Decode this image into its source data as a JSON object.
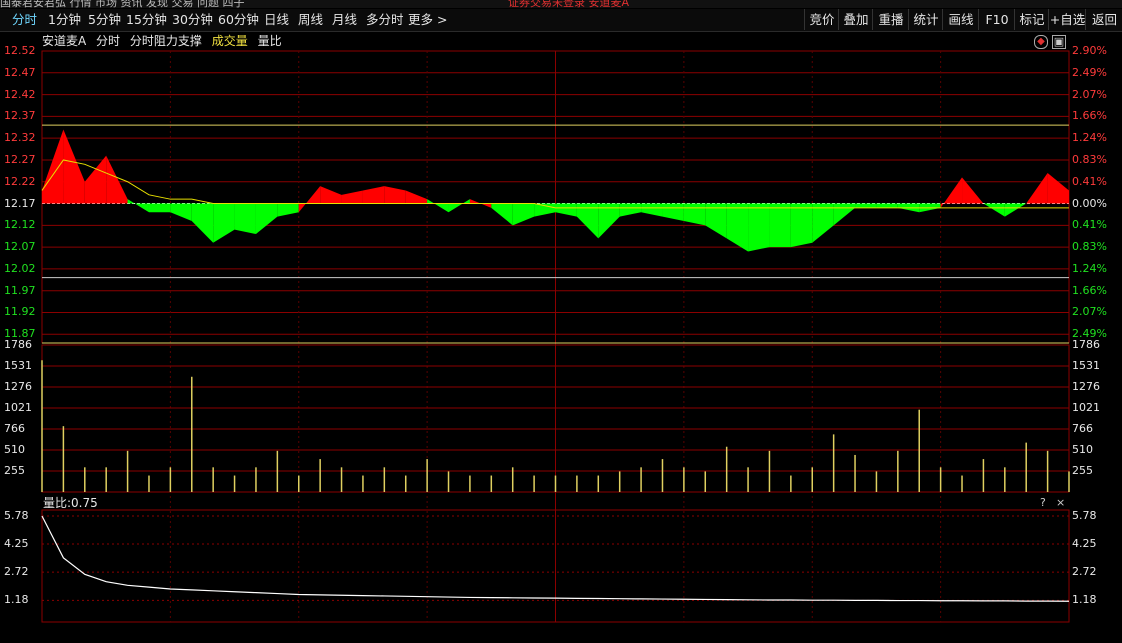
{
  "top_strip": {
    "left_text": "国泰君安君弘 行情 市场 资讯 发现 交易 问题 四子",
    "notice_text": "证券交易未登录  安道麦A"
  },
  "toolbar": {
    "tabs": [
      {
        "label": "分时",
        "active": true
      },
      {
        "label": "1分钟",
        "active": false
      },
      {
        "label": "5分钟",
        "active": false
      },
      {
        "label": "15分钟",
        "active": false
      },
      {
        "label": "30分钟",
        "active": false
      },
      {
        "label": "60分钟",
        "active": false
      },
      {
        "label": "日线",
        "active": false
      },
      {
        "label": "周线",
        "active": false
      },
      {
        "label": "月线",
        "active": false
      },
      {
        "label": "多分时",
        "active": false
      },
      {
        "label": "更多 >",
        "active": false
      }
    ],
    "right_buttons": [
      "竞价",
      "叠加",
      "重播",
      "统计",
      "画线",
      "F10",
      "标记",
      "+自选",
      "返回"
    ]
  },
  "price_panel": {
    "stock_name": "安道麦A",
    "title_items": [
      "分时",
      "分时阻力支撑"
    ],
    "volume_label": "成交量",
    "ratio_label": "量比",
    "prev_close": 12.17,
    "y_labels": [
      "12.52",
      "12.47",
      "12.42",
      "12.37",
      "12.32",
      "12.27",
      "12.22",
      "12.17",
      "12.12",
      "12.07",
      "12.02",
      "11.97",
      "11.92",
      "11.87"
    ],
    "pct_labels": [
      "2.90%",
      "2.49%",
      "2.07%",
      "1.66%",
      "1.24%",
      "0.83%",
      "0.41%",
      "0.00%",
      "0.41%",
      "0.83%",
      "1.24%",
      "1.66%",
      "2.07%",
      "2.49%"
    ],
    "resistance_line": 12.35,
    "support_line": 12.0,
    "colors": {
      "up": "#ff0000",
      "down": "#00ff00",
      "avg": "#e8e000",
      "grid": "#8b0000",
      "baseline": "#ffffff"
    }
  },
  "volume_panel": {
    "y_labels": [
      "1786",
      "1531",
      "1276",
      "1021",
      "766",
      "510",
      "255"
    ]
  },
  "ratio_panel": {
    "header": "量比:0.75",
    "y_labels": [
      "5.78",
      "4.25",
      "2.72",
      "1.18"
    ],
    "help_icon": "?",
    "close_icon": "×"
  },
  "chart_data": {
    "type": "line",
    "x": [
      0,
      5,
      10,
      15,
      20,
      25,
      30,
      35,
      40,
      45,
      50,
      55,
      60,
      65,
      70,
      75,
      80,
      85,
      90,
      95,
      100,
      105,
      110,
      115,
      120,
      125,
      130,
      135,
      140,
      145,
      150,
      155,
      160,
      165,
      170,
      175,
      180,
      185,
      190,
      195,
      200,
      205,
      210,
      215,
      220,
      225,
      230,
      235,
      240
    ],
    "series": [
      {
        "values": [
          12.2,
          12.34,
          12.22,
          12.28,
          12.18,
          12.15,
          12.15,
          12.13,
          12.08,
          12.11,
          12.1,
          12.14,
          12.15,
          12.21,
          12.19,
          12.2,
          12.21,
          12.2,
          12.18,
          12.15,
          12.18,
          12.16,
          12.12,
          12.14,
          12.15,
          12.14,
          12.09,
          12.14,
          12.15,
          12.14,
          12.13,
          12.12,
          12.09,
          12.06,
          12.07,
          12.07,
          12.08,
          12.12,
          12.16,
          12.16,
          12.16,
          12.15,
          12.16,
          12.23,
          12.17,
          12.14,
          12.17,
          12.24,
          12.2
        ]
      },
      {
        "values": [
          12.2,
          12.27,
          12.26,
          12.24,
          12.22,
          12.19,
          12.18,
          12.18,
          12.17,
          12.17,
          12.17,
          12.17,
          12.17,
          12.17,
          12.17,
          12.17,
          12.17,
          12.17,
          12.17,
          12.17,
          12.17,
          12.17,
          12.17,
          12.17,
          12.16,
          12.16,
          12.16,
          12.16,
          12.16,
          12.16,
          12.16,
          12.16,
          12.16,
          12.16,
          12.16,
          12.16,
          12.16,
          12.16,
          12.16,
          12.16,
          12.16,
          12.16,
          12.16,
          12.16,
          12.16,
          12.16,
          12.16,
          12.16,
          12.16
        ]
      }
    ],
    "volume": [
      1600,
      800,
      300,
      300,
      500,
      200,
      300,
      1400,
      300,
      200,
      300,
      500,
      200,
      400,
      300,
      200,
      300,
      200,
      400,
      250,
      200,
      200,
      300,
      200,
      200,
      200,
      200,
      250,
      300,
      400,
      300,
      250,
      550,
      300,
      500,
      200,
      300,
      700,
      450,
      250,
      500,
      1000,
      300,
      200,
      400,
      300,
      600,
      500,
      250
    ],
    "volume_ratio": [
      5.78,
      3.5,
      2.6,
      2.2,
      2.0,
      1.9,
      1.8,
      1.75,
      1.7,
      1.65,
      1.6,
      1.55,
      1.5,
      1.48,
      1.46,
      1.44,
      1.42,
      1.4,
      1.38,
      1.36,
      1.34,
      1.33,
      1.32,
      1.31,
      1.3,
      1.29,
      1.28,
      1.27,
      1.26,
      1.25,
      1.24,
      1.23,
      1.22,
      1.21,
      1.2,
      1.2,
      1.19,
      1.19,
      1.18,
      1.18,
      1.17,
      1.17,
      1.16,
      1.16,
      1.15,
      1.15,
      1.14,
      1.14,
      1.13
    ],
    "ylim": [
      11.85,
      12.52
    ],
    "volume_ylim": [
      0,
      1786
    ],
    "ratio_ylim": [
      0,
      5.78
    ]
  }
}
